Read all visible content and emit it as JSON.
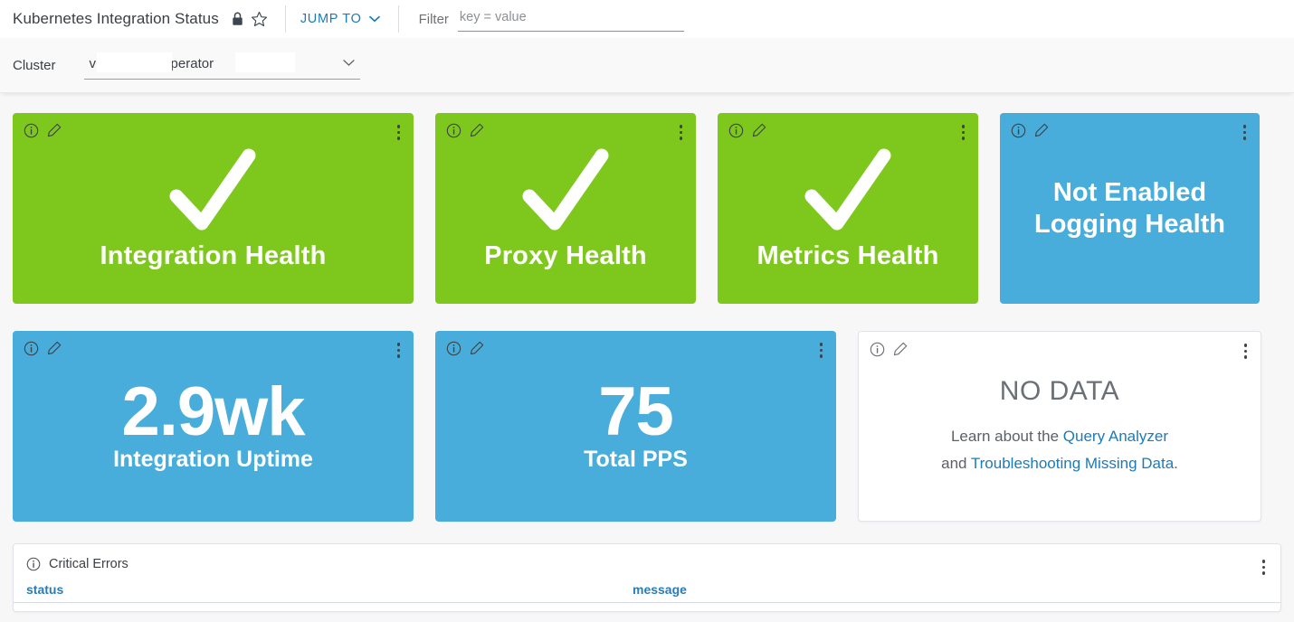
{
  "header": {
    "dashboard_title": "Kubernetes Integration Status",
    "lock_icon": "lock-icon",
    "star_icon": "star-outline-icon",
    "jump_to_label": "JUMP TO",
    "jump_to_chevron": "chevron-down-icon",
    "filter_label": "Filter",
    "filter_placeholder": "key = value",
    "filter_value": ""
  },
  "cluster_bar": {
    "label": "Cluster",
    "selected_value": "v                  t-prod-€          ?-operator",
    "chevron": "chevron-down-icon"
  },
  "cards": {
    "row1": [
      {
        "name": "integration-health",
        "style": "green",
        "status_icon": "check-mark-icon",
        "title": "Integration Health",
        "info_icon": "info-circle-icon",
        "edit_icon": "pencil-icon",
        "menu_icon": "kebab-menu-icon"
      },
      {
        "name": "proxy-health",
        "style": "green",
        "status_icon": "check-mark-icon",
        "title": "Proxy Health",
        "info_icon": "info-circle-icon",
        "edit_icon": "pencil-icon",
        "menu_icon": "kebab-menu-icon"
      },
      {
        "name": "metrics-health",
        "style": "green",
        "status_icon": "check-mark-icon",
        "title": "Metrics Health",
        "info_icon": "info-circle-icon",
        "edit_icon": "pencil-icon",
        "menu_icon": "kebab-menu-icon"
      },
      {
        "name": "logging-health",
        "style": "blue",
        "value": "Not Enabled",
        "title": "Logging Health",
        "info_icon": "info-circle-icon",
        "edit_icon": "pencil-icon",
        "menu_icon": "kebab-menu-icon"
      }
    ],
    "row2": [
      {
        "name": "integration-uptime",
        "style": "blue",
        "value": "2.9wk",
        "title": "Integration Uptime",
        "info_icon": "info-circle-icon",
        "edit_icon": "pencil-icon",
        "menu_icon": "kebab-menu-icon"
      },
      {
        "name": "total-pps",
        "style": "blue",
        "value": "75",
        "title": "Total PPS",
        "info_icon": "info-circle-icon",
        "edit_icon": "pencil-icon",
        "menu_icon": "kebab-menu-icon"
      },
      {
        "name": "no-data-card",
        "style": "white",
        "value": "NO DATA",
        "line1_prefix": "Learn about the ",
        "line1_link": "Query Analyzer",
        "line2_prefix": "and ",
        "line2_link": "Troubleshooting Missing Data",
        "line2_suffix": ".",
        "info_icon": "info-circle-icon",
        "edit_icon": "pencil-icon",
        "menu_icon": "kebab-menu-icon"
      }
    ]
  },
  "critical_errors": {
    "title": "Critical Errors",
    "info_icon": "info-circle-icon",
    "menu_icon": "kebab-menu-icon",
    "columns": [
      "status",
      "message"
    ]
  },
  "colors": {
    "green": "#7ec81e",
    "blue": "#48addb",
    "link": "#1a7bb9",
    "table_header": "#2b7cb5",
    "page_background": "#f7f7f8",
    "bar_background": "#f9f9f9"
  }
}
